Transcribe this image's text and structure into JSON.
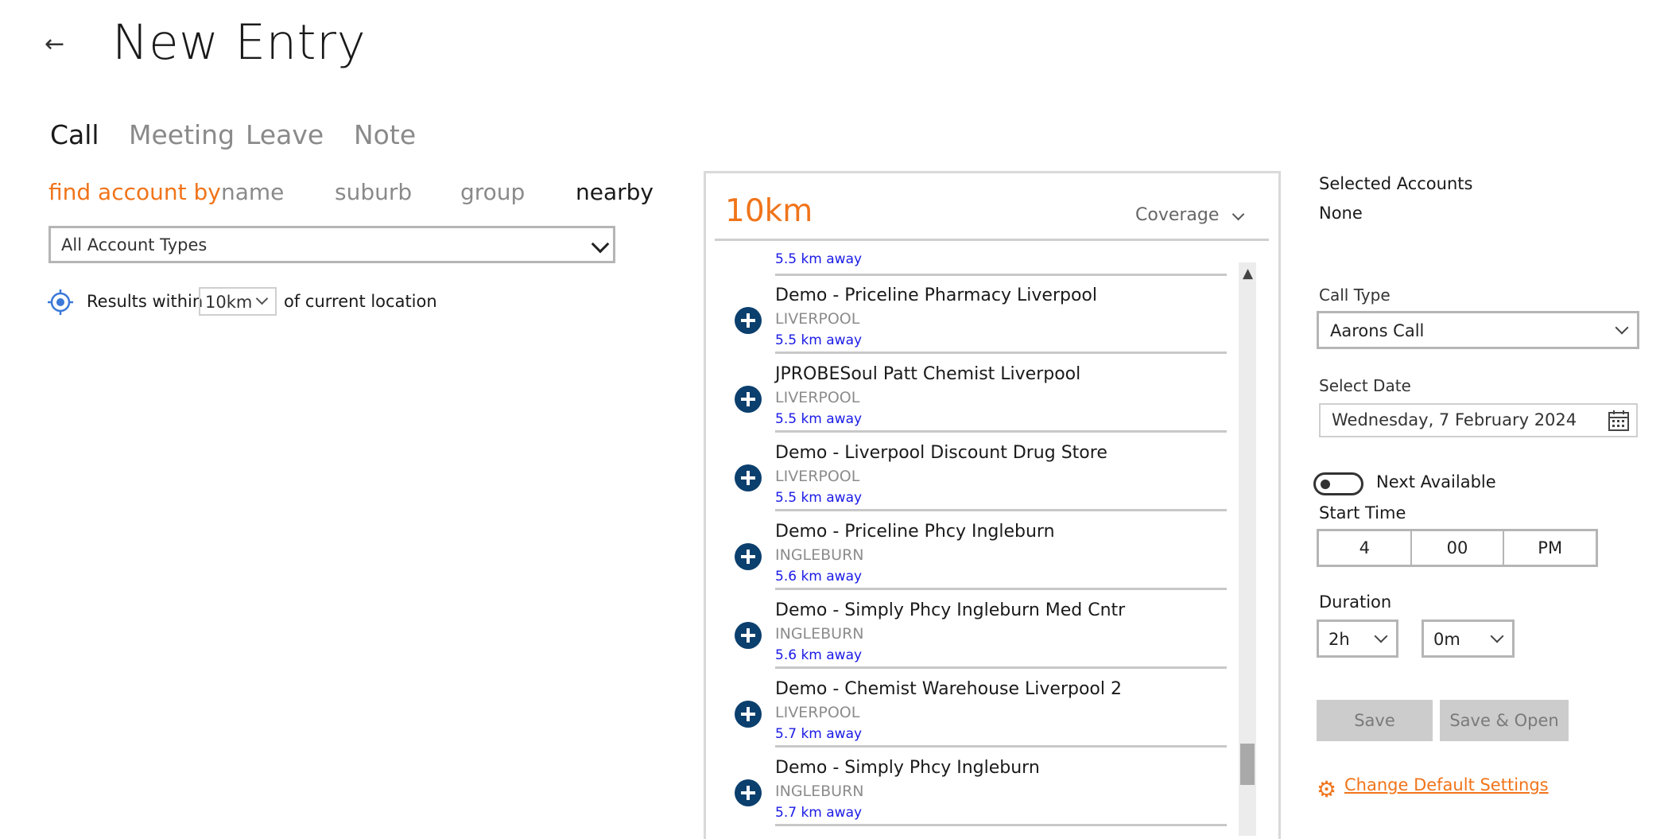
{
  "header": {
    "back_icon": "←",
    "title": "New Entry"
  },
  "tabs": [
    {
      "label": "Call",
      "active": true
    },
    {
      "label": "Meeting",
      "active": false
    },
    {
      "label": "Leave",
      "active": false
    },
    {
      "label": "Note",
      "active": false
    }
  ],
  "find": {
    "label": "find account by",
    "options": [
      {
        "label": "name",
        "active": false
      },
      {
        "label": "suburb",
        "active": false
      },
      {
        "label": "group",
        "active": false
      },
      {
        "label": "nearby",
        "active": true
      }
    ]
  },
  "account_type": {
    "value": "All Account Types"
  },
  "location": {
    "prefix": "Results within",
    "distance": "10km",
    "suffix": "of current location"
  },
  "results_panel": {
    "radius": "10km",
    "sort": "Coverage",
    "partial_top_item_distance": "5.5 km away",
    "items": [
      {
        "name": "Demo - Priceline Pharmacy Liverpool",
        "suburb": "LIVERPOOL",
        "distance": "5.5 km away"
      },
      {
        "name": "JPROBESoul Patt Chemist Liverpool",
        "suburb": "LIVERPOOL",
        "distance": "5.5 km away"
      },
      {
        "name": "Demo - Liverpool Discount Drug Store",
        "suburb": "LIVERPOOL",
        "distance": "5.5 km away"
      },
      {
        "name": "Demo - Priceline Phcy Ingleburn",
        "suburb": "INGLEBURN",
        "distance": "5.6 km away"
      },
      {
        "name": "Demo - Simply Phcy Ingleburn Med Cntr",
        "suburb": "INGLEBURN",
        "distance": "5.6 km away"
      },
      {
        "name": "Demo - Chemist Warehouse Liverpool 2",
        "suburb": "LIVERPOOL",
        "distance": "5.7 km away"
      },
      {
        "name": "Demo - Simply Phcy Ingleburn",
        "suburb": "INGLEBURN",
        "distance": "5.7 km away"
      }
    ],
    "scroll_up_icon": "▲"
  },
  "selected_accounts": {
    "label": "Selected Accounts",
    "value": "None"
  },
  "call_type": {
    "label": "Call Type",
    "value": "Aarons Call"
  },
  "select_date": {
    "label": "Select Date",
    "value": "Wednesday, 7 February 2024"
  },
  "next_available": {
    "label": "Next Available",
    "on": false
  },
  "start_time": {
    "label": "Start Time",
    "hour": "4",
    "minute": "00",
    "period": "PM"
  },
  "duration": {
    "label": "Duration",
    "hours": "2h",
    "minutes": "0m"
  },
  "actions": {
    "save": "Save",
    "save_open": "Save & Open"
  },
  "settings": {
    "icon": "⚙",
    "link": "Change Default Settings"
  },
  "colors": {
    "accent": "#f0741a",
    "link_blue": "#1a1ae6",
    "add_button": "#0b3f6d"
  }
}
